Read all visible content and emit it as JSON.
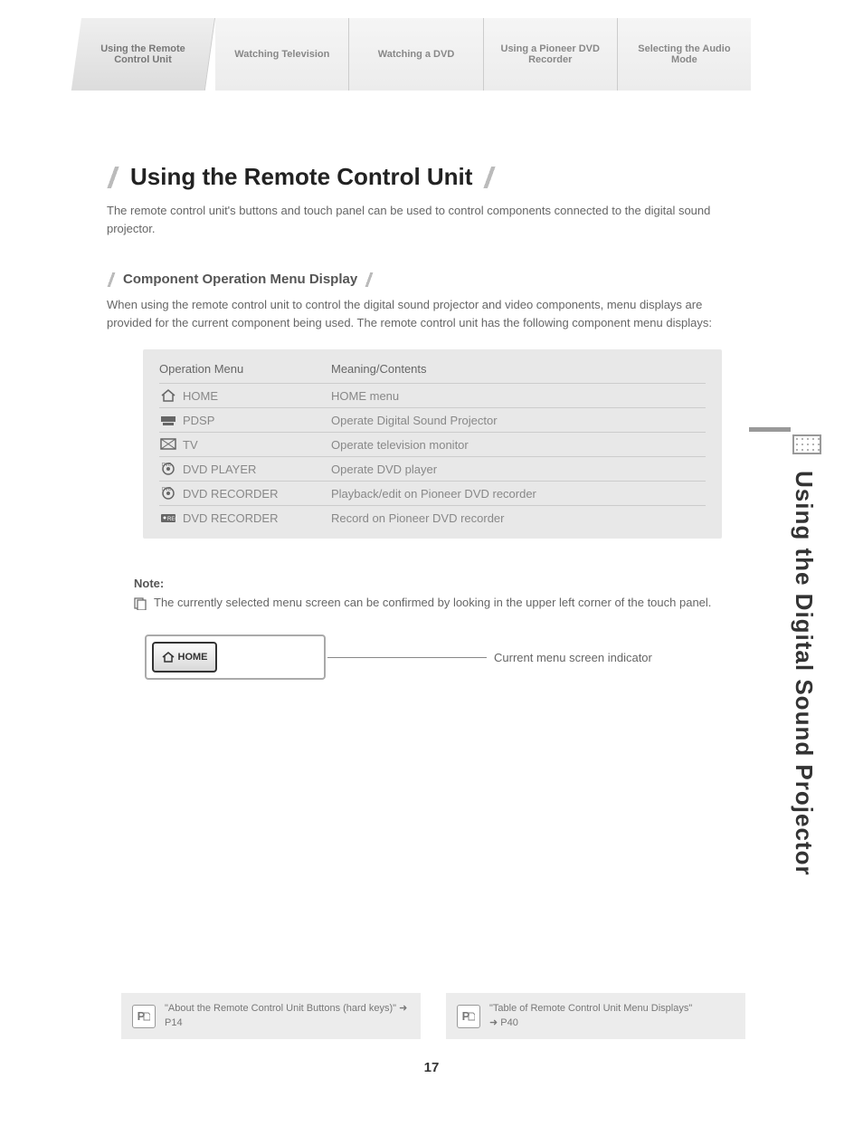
{
  "tabs": [
    "Using the Remote Control Unit",
    "Watching Television",
    "Watching a DVD",
    "Using a Pioneer DVD Recorder",
    "Selecting the Audio Mode"
  ],
  "h1": "Using the Remote Control Unit",
  "intro": "The remote control unit's buttons and touch panel can be used to control components connected to the digital sound projector.",
  "h2": "Component Operation Menu Display",
  "sub": "When using the remote control unit to control the digital sound projector and video components, menu displays are provided for the current component being used. The remote control unit has the following component menu displays:",
  "table": {
    "header": {
      "c1": "Operation Menu",
      "c2": "Meaning/Contents"
    },
    "rows": [
      {
        "icon": "home",
        "c1": "HOME",
        "c2": "HOME menu"
      },
      {
        "icon": "pdsp",
        "c1": "PDSP",
        "c2": "Operate Digital Sound Projector"
      },
      {
        "icon": "tv",
        "c1": "TV",
        "c2": "Operate television monitor"
      },
      {
        "icon": "dvd",
        "c1": "DVD PLAYER",
        "c2": "Operate DVD player"
      },
      {
        "icon": "dvdrec",
        "c1": "DVD RECORDER",
        "c2": "Playback/edit on Pioneer DVD recorder"
      },
      {
        "icon": "rec",
        "c1": "DVD RECORDER",
        "c2": "Record on Pioneer DVD recorder"
      }
    ]
  },
  "note": {
    "title": "Note:",
    "text": "The currently selected menu screen can be confirmed by looking in the upper left corner of the touch panel."
  },
  "indicator": {
    "chip": "HOME",
    "label": "Current menu screen indicator"
  },
  "side": "Using the Digital Sound Projector",
  "refs": [
    {
      "title": "\"About the Remote Control Unit Buttons (hard keys)\"",
      "page": "P14"
    },
    {
      "title": "\"Table of Remote Control Unit Menu Displays\"",
      "page": "P40"
    }
  ],
  "page_number": "17"
}
